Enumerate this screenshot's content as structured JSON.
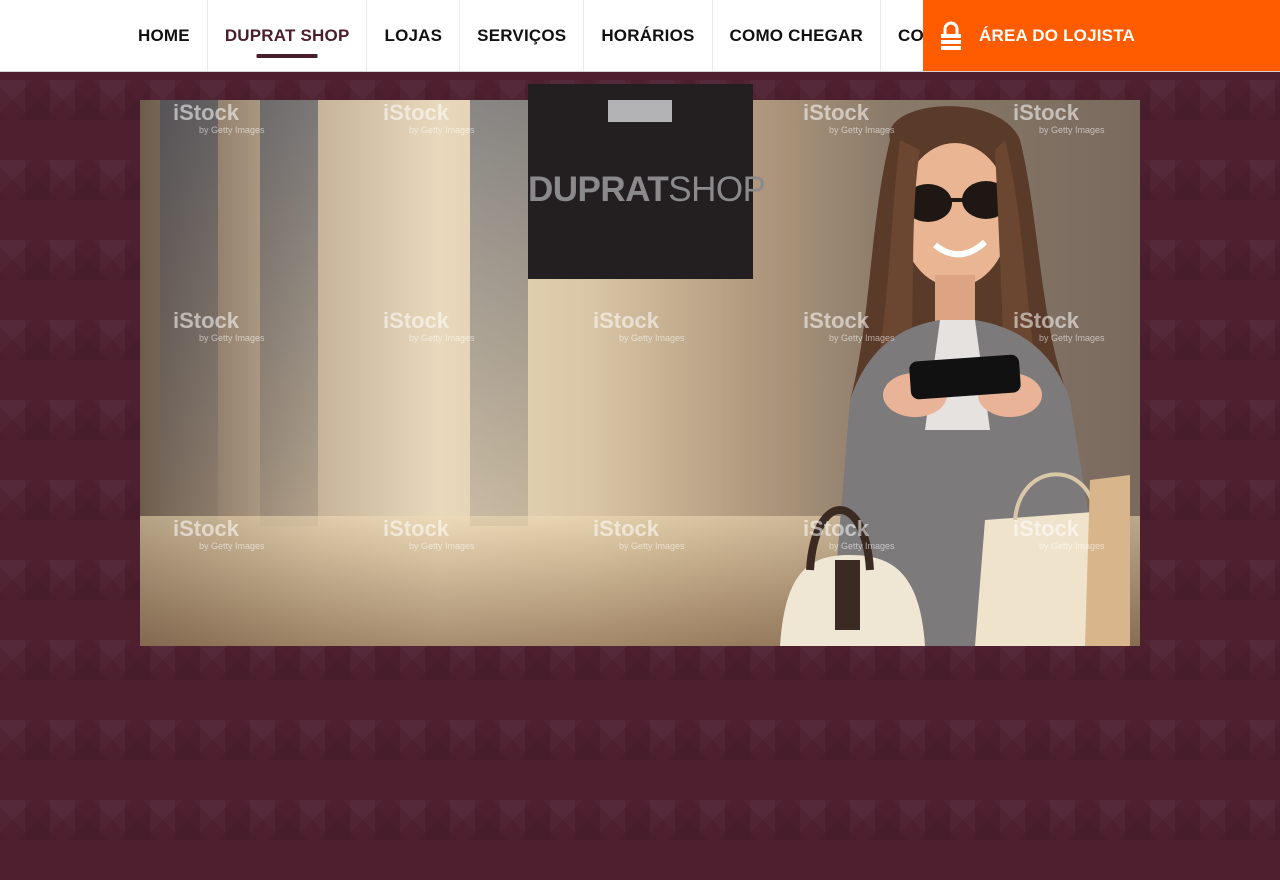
{
  "nav": {
    "items": [
      {
        "label": "HOME",
        "active": false
      },
      {
        "label": "DUPRAT SHOP",
        "active": true
      },
      {
        "label": "LOJAS",
        "active": false
      },
      {
        "label": "SERVIÇOS",
        "active": false
      },
      {
        "label": "HORÁRIOS",
        "active": false
      },
      {
        "label": "COMO CHEGAR",
        "active": false
      },
      {
        "label": "CONTATO",
        "active": false
      }
    ],
    "lojista_label": "ÁREA DO LOJISTA",
    "lojista_icon": "lock-icon",
    "accent_color": "#ff5c00",
    "active_color": "#4a1e2c"
  },
  "logo": {
    "bold": "DUPRAT",
    "light": "SHOP"
  },
  "hero": {
    "watermark": "iStock",
    "watermark_sub": "by Getty Images"
  },
  "colors": {
    "background": "#4d1f2f",
    "logo_background": "#231f20"
  }
}
